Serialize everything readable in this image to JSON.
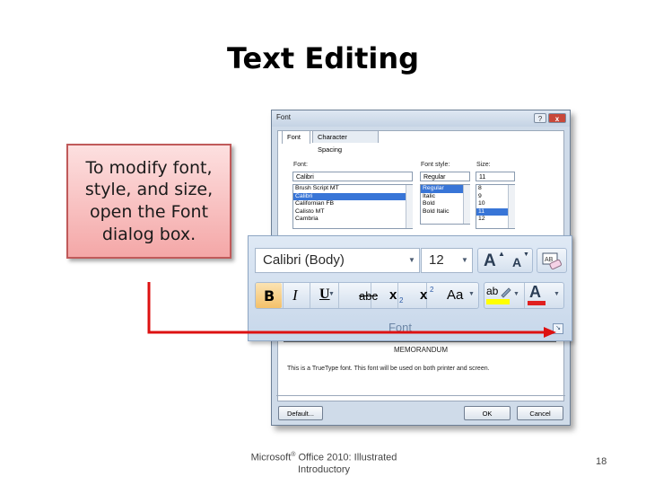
{
  "slide": {
    "title": "Text Editing",
    "callout": "To modify font, style, and size, open the Font dialog box.",
    "footer": {
      "prefix": "Microsoft",
      "reg_mark": "®",
      "rest": " Office 2010: Illustrated Introductory"
    },
    "page_number": "18"
  },
  "dialog": {
    "title": "Font",
    "help_glyph": "?",
    "close_glyph": "x",
    "tabs": [
      "Font",
      "Character Spacing"
    ],
    "font_label": "Font:",
    "font_value": "Calibri",
    "font_list": [
      "Brush Script MT",
      "Calibri",
      "Californian FB",
      "Calisto MT",
      "Cambria"
    ],
    "font_selected_index": 1,
    "style_label": "Font style:",
    "style_value": "Regular",
    "style_list": [
      "Regular",
      "Italic",
      "Bold",
      "Bold Italic"
    ],
    "style_selected_index": 0,
    "size_label": "Size:",
    "size_value": "11",
    "size_list": [
      "8",
      "9",
      "10",
      "11",
      "12"
    ],
    "size_selected_index": 3,
    "preview_text": "MEMORANDUM",
    "preview_description": "This is a TrueType font. This font will be used on both printer and screen.",
    "default_button": "Default...",
    "ok_button": "OK",
    "cancel_button": "Cancel"
  },
  "ribbon": {
    "font_name": "Calibri (Body)",
    "font_size": "12",
    "grow_font": "A",
    "shrink_font": "A",
    "bold": "B",
    "italic": "I",
    "underline": "U",
    "strikethrough": "abc",
    "subscript": "x",
    "superscript": "x",
    "change_case": "Aa",
    "highlight_label": "ab",
    "font_color": "A",
    "group_label": "Font",
    "colors": {
      "highlight": "#ffff00",
      "font_color": "#e02020",
      "arrow": "#dd1111"
    }
  }
}
